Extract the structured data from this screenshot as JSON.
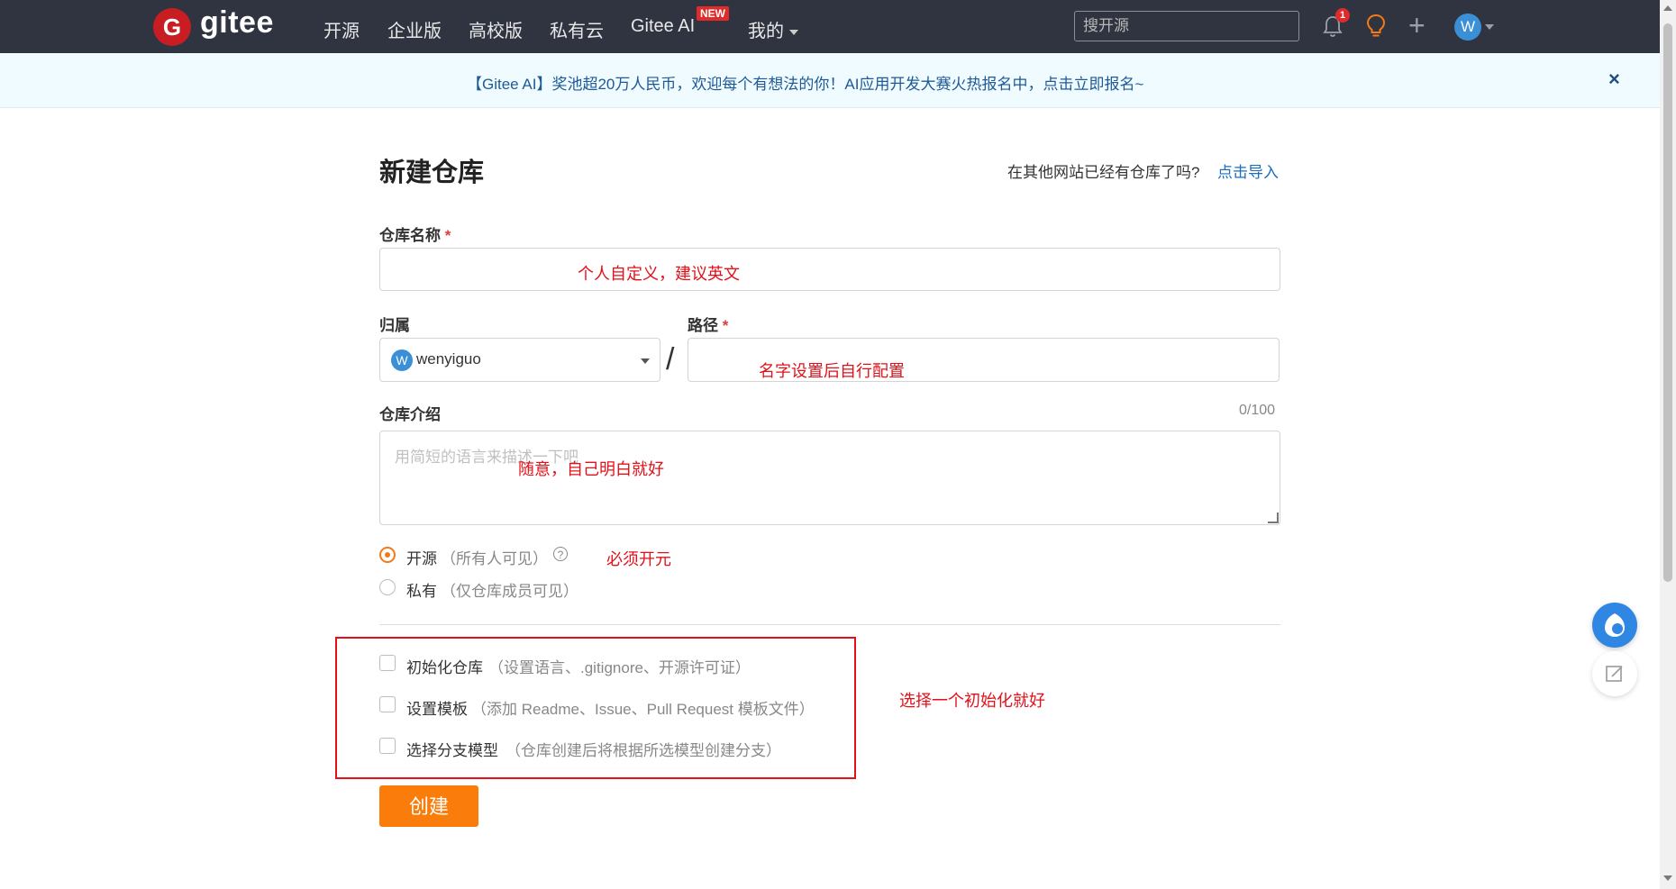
{
  "brand": {
    "logo_letter": "G",
    "name": "gitee"
  },
  "nav": {
    "items": [
      "开源",
      "企业版",
      "高校版",
      "私有云",
      "Gitee AI",
      "我的"
    ],
    "new_badge": "NEW",
    "search_placeholder": "搜开源",
    "notification_count": "1",
    "avatar_letter": "W"
  },
  "banner": {
    "text": "【Gitee AI】奖池超20万人民币，欢迎每个有想法的你！AI应用开发大赛火热报名中，点击立即报名~",
    "close": "×"
  },
  "page": {
    "title": "新建仓库",
    "import_question": "在其他网站已经有仓库了吗?",
    "import_link": "点击导入"
  },
  "form": {
    "repo_name_label": "仓库名称",
    "required_mark": "*",
    "owner_label": "归属",
    "owner_avatar": "W",
    "owner_value": "wenyiguo",
    "separator": "/",
    "path_label": "路径",
    "desc_label": "仓库介绍",
    "desc_counter": "0/100",
    "desc_placeholder": "用简短的语言来描述一下吧",
    "visibility": [
      {
        "label": "开源",
        "hint": "（所有人可见）",
        "selected": true
      },
      {
        "label": "私有",
        "hint": "（仅仓库成员可见）",
        "selected": false
      }
    ],
    "help_glyph": "?",
    "options": [
      {
        "label": "初始化仓库",
        "hint": "（设置语言、.gitignore、开源许可证）",
        "checked": false
      },
      {
        "label": "设置模板",
        "hint": "（添加 Readme、Issue、Pull Request 模板文件）",
        "checked": false
      },
      {
        "label": "选择分支模型",
        "hint": "（仓库创建后将根据所选模型创建分支）",
        "checked": false
      }
    ],
    "submit_label": "创建"
  },
  "annotations": {
    "name": "个人自定义，建议英文",
    "path": "名字设置后自行配置",
    "desc": "随意，自己明白就好",
    "visibility": "必须开元",
    "init": "选择一个初始化就好"
  },
  "colors": {
    "nav_bg": "#2f3440",
    "brand_red": "#c71d23",
    "accent_orange": "#fa7c0b",
    "link_blue": "#1a6dbf",
    "annotation_red": "#e3101a"
  }
}
